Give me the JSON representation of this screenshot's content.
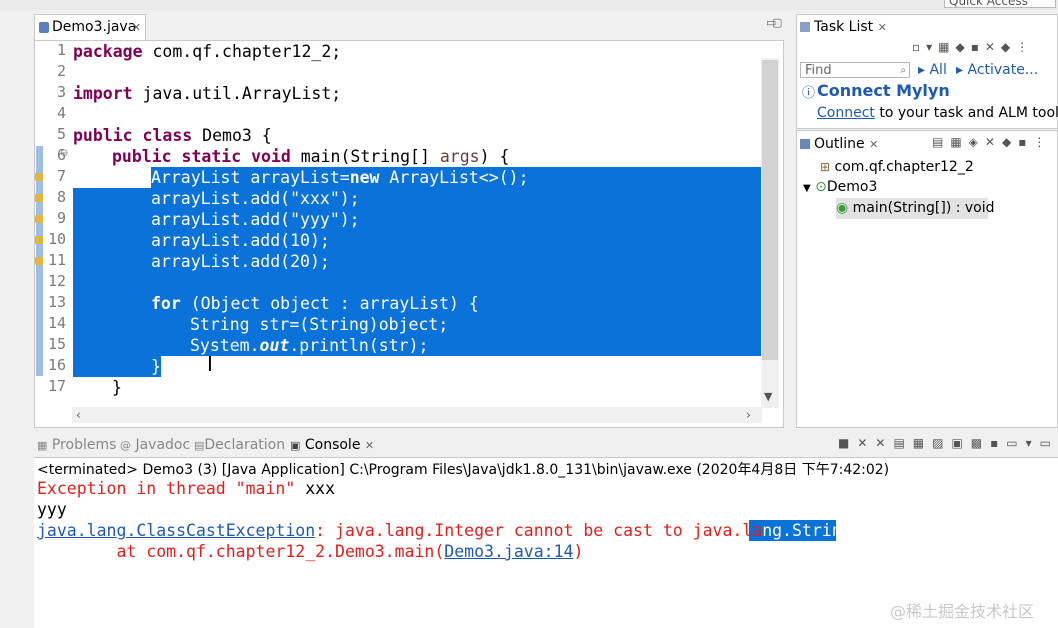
{
  "top": {
    "quick_access": "Quick Access"
  },
  "editor": {
    "tab_label": "Demo3.java",
    "close_glyph": "☒",
    "line_numbers": [
      "1",
      "2",
      "3",
      "4",
      "5",
      "6",
      "7",
      "8",
      "9",
      "10",
      "11",
      "12",
      "13",
      "14",
      "15",
      "16",
      "17"
    ],
    "lines": {
      "l1a": "package",
      "l1b": " com.qf.chapter12_2;",
      "l3a": "import",
      "l3b": " java.util.ArrayList;",
      "l5a": "public class",
      "l5b": " Demo3 {",
      "l6a": "public static void",
      "l6b": " main(String[] ",
      "l6c": "args",
      "l6d": ") {",
      "l7a": "ArrayList arrayList=",
      "l7b": "new",
      "l7c": " ArrayList<>();",
      "l8a": "arrayList.add(",
      "l8b": "\"xxx\"",
      "l8c": ");",
      "l9a": "arrayList.add(",
      "l9b": "\"yyy\"",
      "l9c": ");",
      "l10": "arrayList.add(10);",
      "l11": "arrayList.add(20);",
      "l13a": "for",
      "l13b": " (Object object : arrayList) {",
      "l14": "String str=(String)object;",
      "l15a": "System.",
      "l15b": "out",
      "l15c": ".println(str);",
      "l16": "}",
      "l17": "}"
    }
  },
  "tasklist": {
    "tab_label": "Task List",
    "find_placeholder": "Find",
    "all_label": "All",
    "activate_label": "Activate...",
    "mylyn_title": "Connect Mylyn",
    "connect_link": "Connect",
    "connect_rest": " to your task and ALM tools o"
  },
  "outline": {
    "tab_label": "Outline",
    "package": "com.qf.chapter12_2",
    "class": "Demo3",
    "method": "main(String[]) : void"
  },
  "bottom": {
    "tabs": [
      "Problems",
      "Javadoc",
      "Declaration",
      "Console"
    ],
    "console_header": "<terminated> Demo3 (3) [Java Application] C:\\Program Files\\Java\\jdk1.8.0_131\\bin\\javaw.exe (2020年4月8日 下午7:42:02)",
    "line1": "Exception in thread \"main\" ",
    "line1b": "xxx",
    "line2": "yyy",
    "line3_link": "java.lang.ClassCastException",
    "line3_rest_a": ": java.lang.Integer cannot be cast to java.la",
    "line3_rest_b": "ng.String",
    "line4_pre": "        at com.qf.chapter12_2.Demo3.main(",
    "line4_link": "Demo3.java:14",
    "line4_post": ")"
  },
  "watermark": "@稀土掘金技术社区"
}
